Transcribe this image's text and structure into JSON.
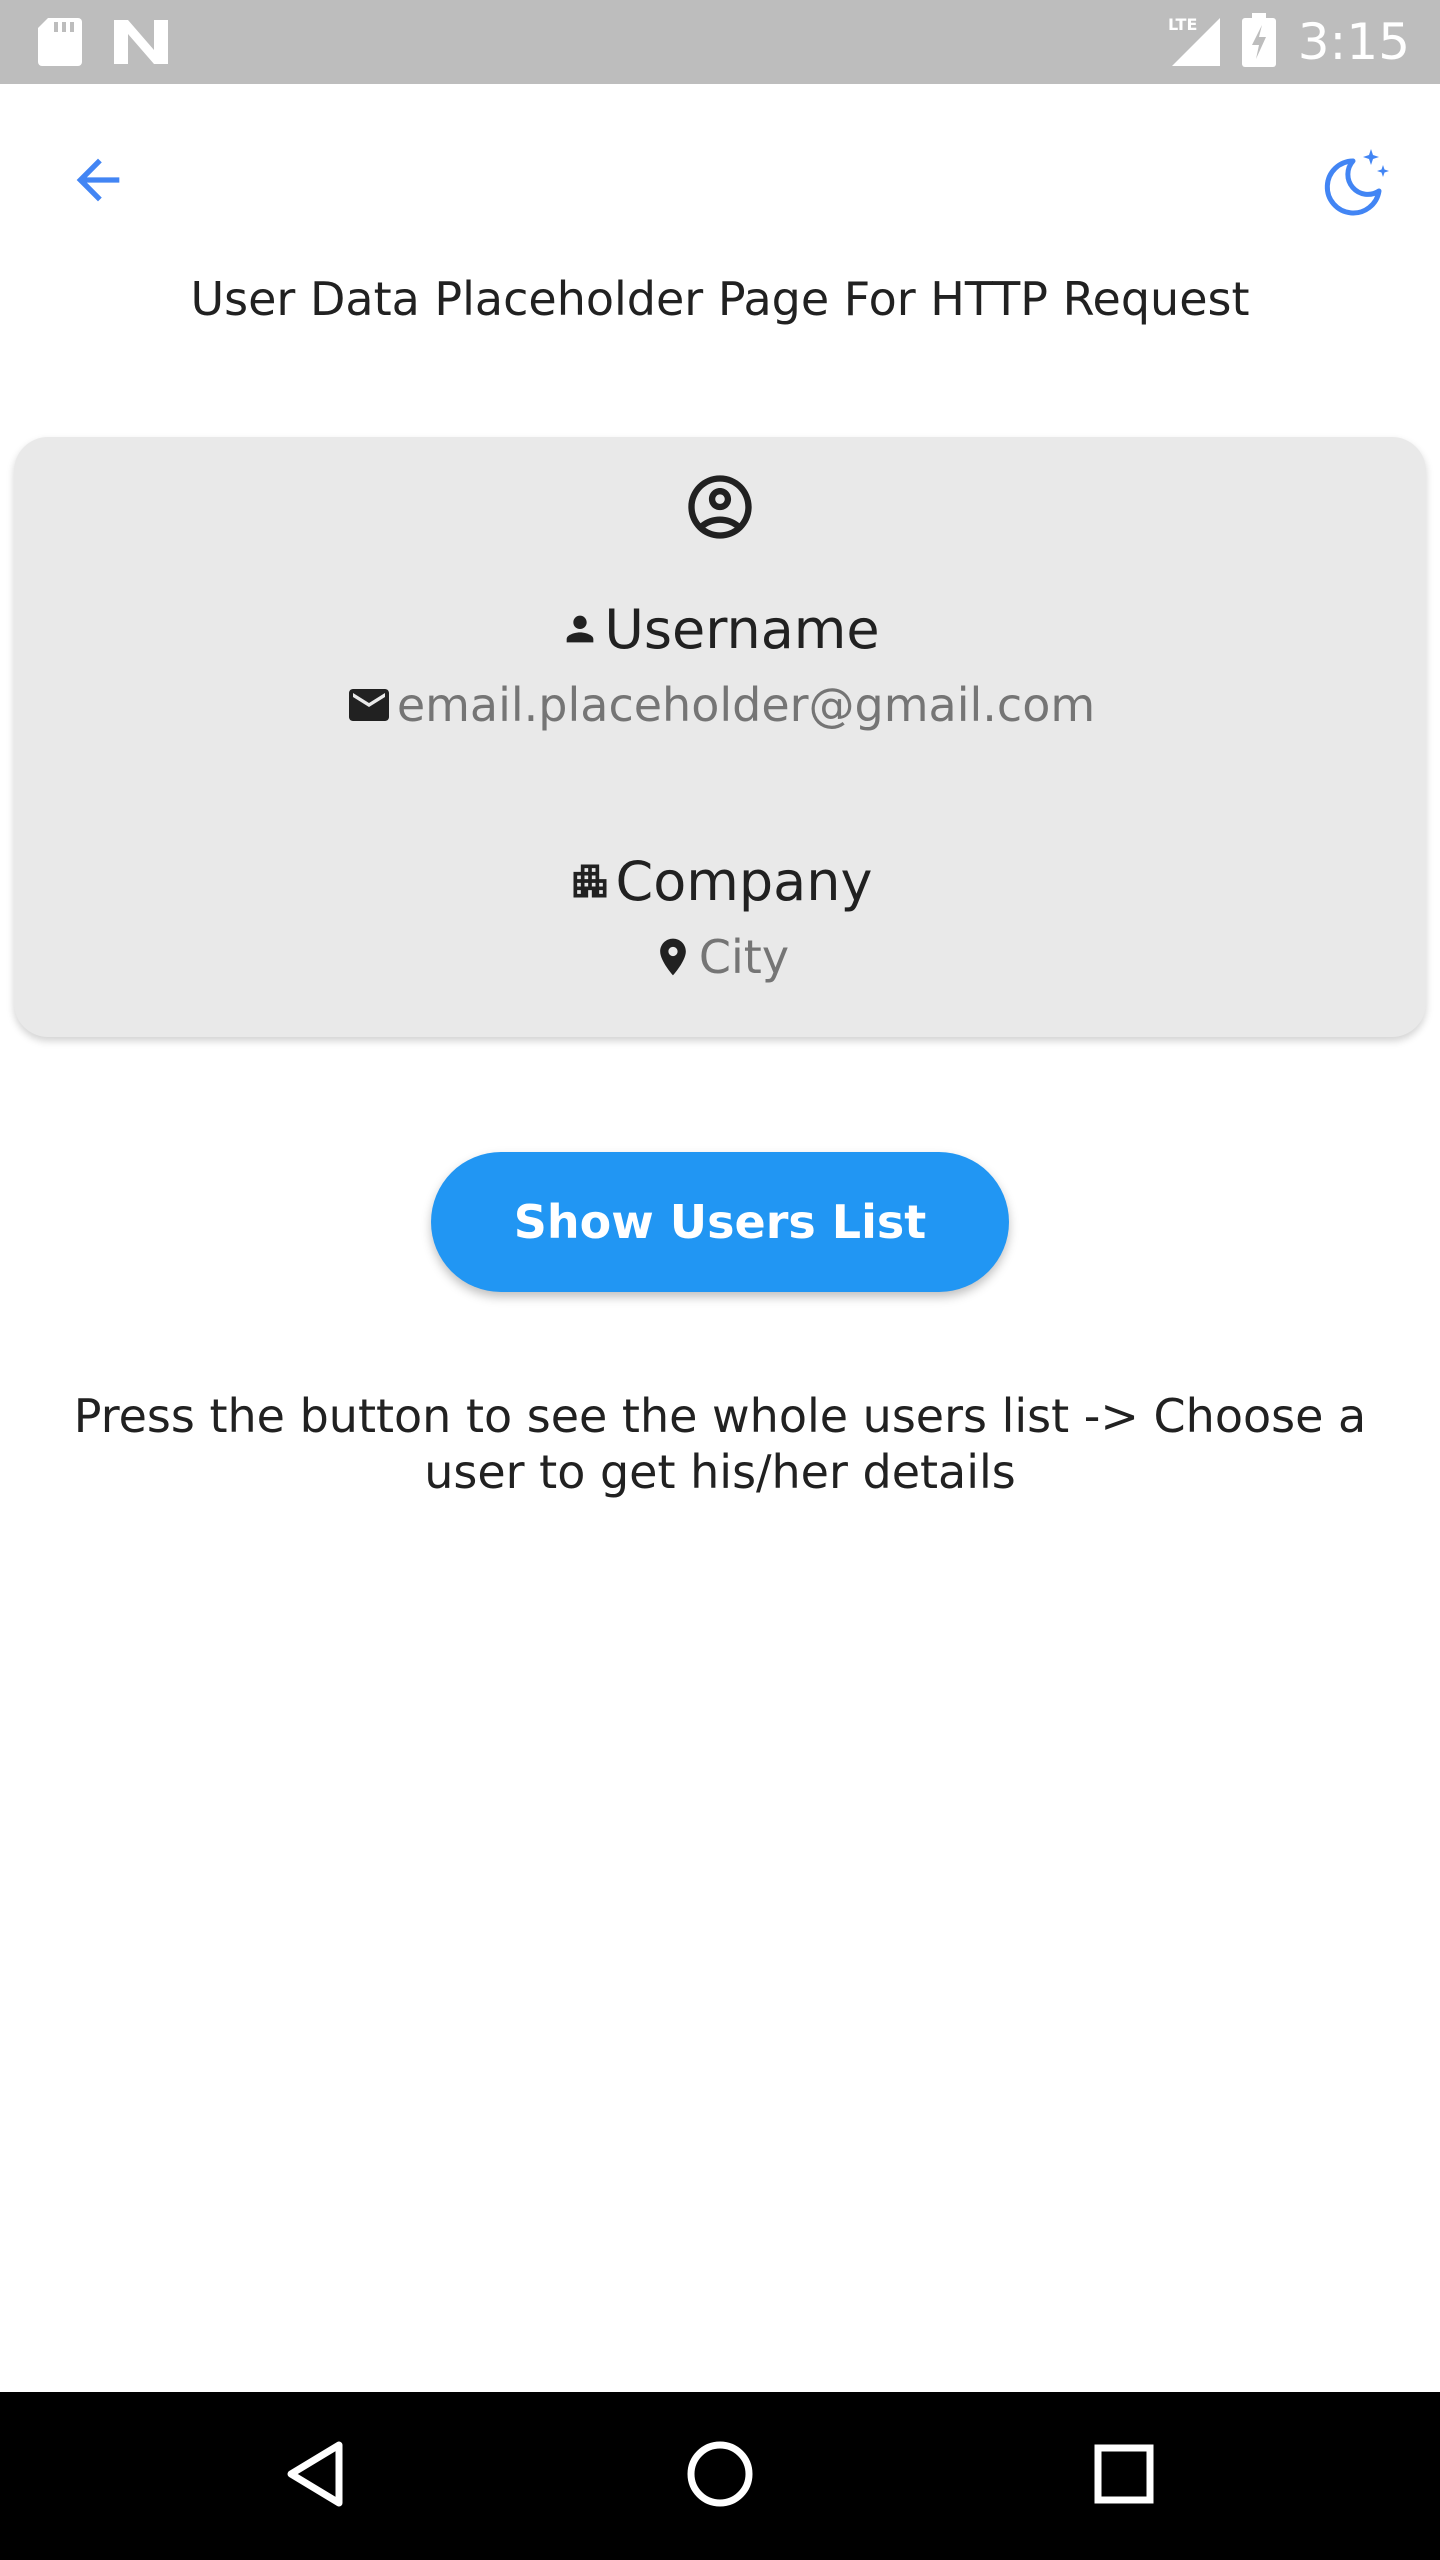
{
  "status_bar": {
    "time": "3:15",
    "network": "LTE"
  },
  "app_bar": {
    "back_icon": "arrow-back-icon",
    "theme_icon": "dark-mode-icon",
    "accent_color": "#4285f4"
  },
  "page": {
    "title": "User Data Placeholder Page For HTTP Request"
  },
  "card": {
    "avatar_icon": "account-circle-icon",
    "username": "Username",
    "email": "email.placeholder@gmail.com",
    "company": "Company",
    "city": "City"
  },
  "actions": {
    "show_users_label": "Show Users List",
    "button_color": "#2196f3"
  },
  "hint": {
    "text": "Press the button to see the whole users list -> Choose a user to get his/her details"
  },
  "nav_bar": {
    "back": "nav-back-icon",
    "home": "nav-home-icon",
    "recents": "nav-recents-icon"
  }
}
